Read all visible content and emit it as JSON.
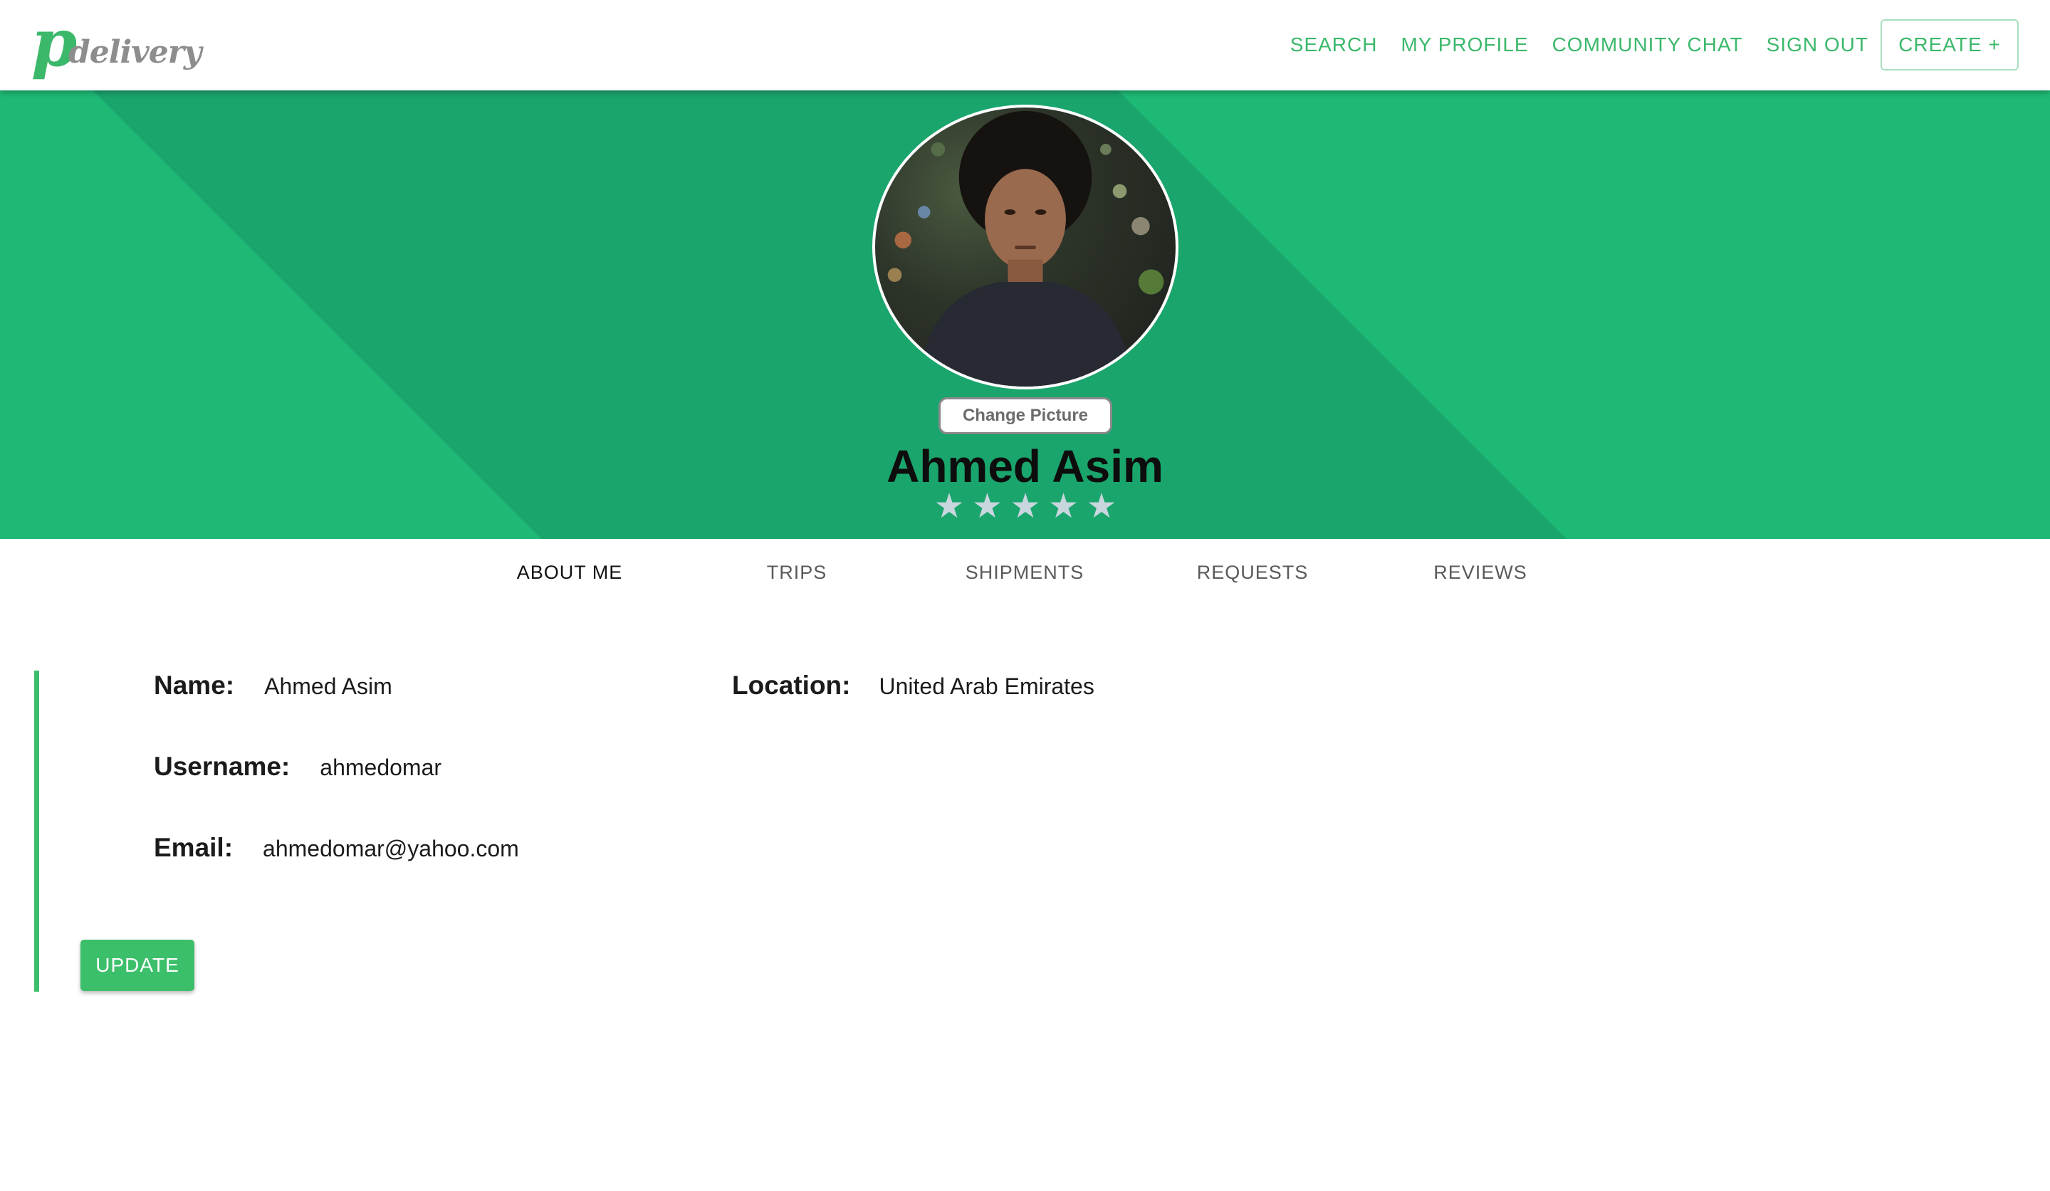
{
  "brand": {
    "logo_letter": "p",
    "logo_text": "delivery"
  },
  "nav": {
    "items": [
      "SEARCH",
      "MY PROFILE",
      "COMMUNITY CHAT",
      "SIGN OUT"
    ],
    "create_label": "CREATE +"
  },
  "profile": {
    "change_picture_label": "Change Picture",
    "name": "Ahmed Asim",
    "rating_stars": 5,
    "star_glyph": "★"
  },
  "tabs": [
    "ABOUT ME",
    "TRIPS",
    "SHIPMENTS",
    "REQUESTS",
    "REVIEWS"
  ],
  "active_tab": "ABOUT ME",
  "about": {
    "name_label": "Name:",
    "name_value": "Ahmed Asim",
    "location_label": "Location:",
    "location_value": "United Arab Emirates",
    "username_label": "Username:",
    "username_value": "ahmedomar",
    "email_label": "Email:",
    "email_value": "ahmedomar@yahoo.com",
    "update_label": "UPDATE"
  },
  "colors": {
    "accent": "#3cb86b",
    "hero_light": "#1eba75",
    "hero_dark": "#1aa56c",
    "star": "#c8d6de"
  }
}
